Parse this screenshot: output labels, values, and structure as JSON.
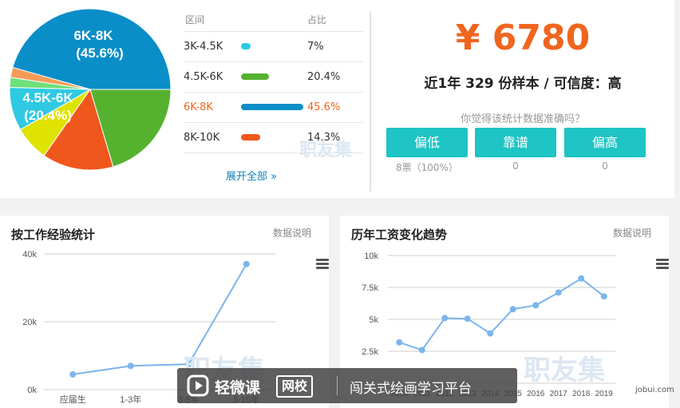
{
  "distribution": {
    "header": {
      "range": "区间",
      "share": "占比"
    },
    "chart_data": {
      "type": "pie",
      "categories": [
        "6K-8K",
        "4.5K-6K",
        "8K-10K",
        "3K-4.5K",
        "",
        "",
        ""
      ],
      "values": [
        45.6,
        20.4,
        14.3,
        7,
        8.7,
        2,
        2
      ],
      "colors": [
        "#0a8ec8",
        "#55b22f",
        "#f0571d",
        "#dfe300",
        "#2fc9e2",
        "#6ee07a",
        "#f49b59"
      ]
    },
    "pie_labels": [
      {
        "name": "6K-8K",
        "pct": "(45.6%)"
      },
      {
        "name": "4.5K-6K",
        "pct": "(20.4%)"
      }
    ],
    "rows": [
      {
        "label": "3K-4.5K",
        "pct": "7%",
        "value": 7,
        "color": "#2fc9e2"
      },
      {
        "label": "4.5K-6K",
        "pct": "20.4%",
        "value": 20.4,
        "color": "#55b22f"
      },
      {
        "label": "6K-8K",
        "pct": "45.6%",
        "value": 45.6,
        "color": "#0a8ec8"
      },
      {
        "label": "8K-10K",
        "pct": "14.3%",
        "value": 14.3,
        "color": "#f0571d"
      }
    ],
    "expand_all": "展开全部 »",
    "watermark": "职友集"
  },
  "summary": {
    "salary": "¥ 6780",
    "sample_text": "近1年 329 份样本 / 可信度：高",
    "question": "你觉得该统计数据准确吗？",
    "buttons": [
      {
        "label": "偏低",
        "count": "8票（100%）"
      },
      {
        "label": "靠谱",
        "count": "0"
      },
      {
        "label": "偏高",
        "count": "0"
      }
    ],
    "accent_color": "#f0651f",
    "button_color": "#1fc4c4"
  },
  "experience": {
    "title": "按工作经验统计",
    "note": "数据说明",
    "chart_data": {
      "type": "line",
      "categories": [
        "应届生",
        "1-3年",
        "3-5年",
        "5-10年"
      ],
      "values": [
        4500,
        7000,
        7500,
        37000
      ],
      "ylim": [
        0,
        40000
      ],
      "ytick_values": [
        0,
        20000,
        40000
      ],
      "ytick_labels": [
        "0k",
        "20k",
        "40k"
      ],
      "color": "#7cb5ec"
    },
    "watermark": "职友集"
  },
  "history": {
    "title": "历年工资变化趋势",
    "note": "数据说明",
    "chart_data": {
      "type": "line",
      "categories": [
        "2010",
        "2011",
        "2012",
        "2013",
        "2014",
        "2015",
        "2016",
        "2017",
        "2018",
        "2019"
      ],
      "values": [
        3200,
        2600,
        5100,
        5050,
        3900,
        5800,
        6100,
        7100,
        8200,
        6800
      ],
      "ylim": [
        0,
        10000
      ],
      "ytick_values": [
        2500,
        5000,
        7500,
        10000
      ],
      "ytick_labels": [
        "2.5k",
        "5k",
        "7.5k",
        "10k"
      ],
      "color": "#7cb5ec"
    },
    "watermark": "职友集",
    "credit": "jobui.com"
  },
  "banner": {
    "brand": "轻微课",
    "tag": "网校",
    "slogan": "闯关式绘画学习平台"
  }
}
